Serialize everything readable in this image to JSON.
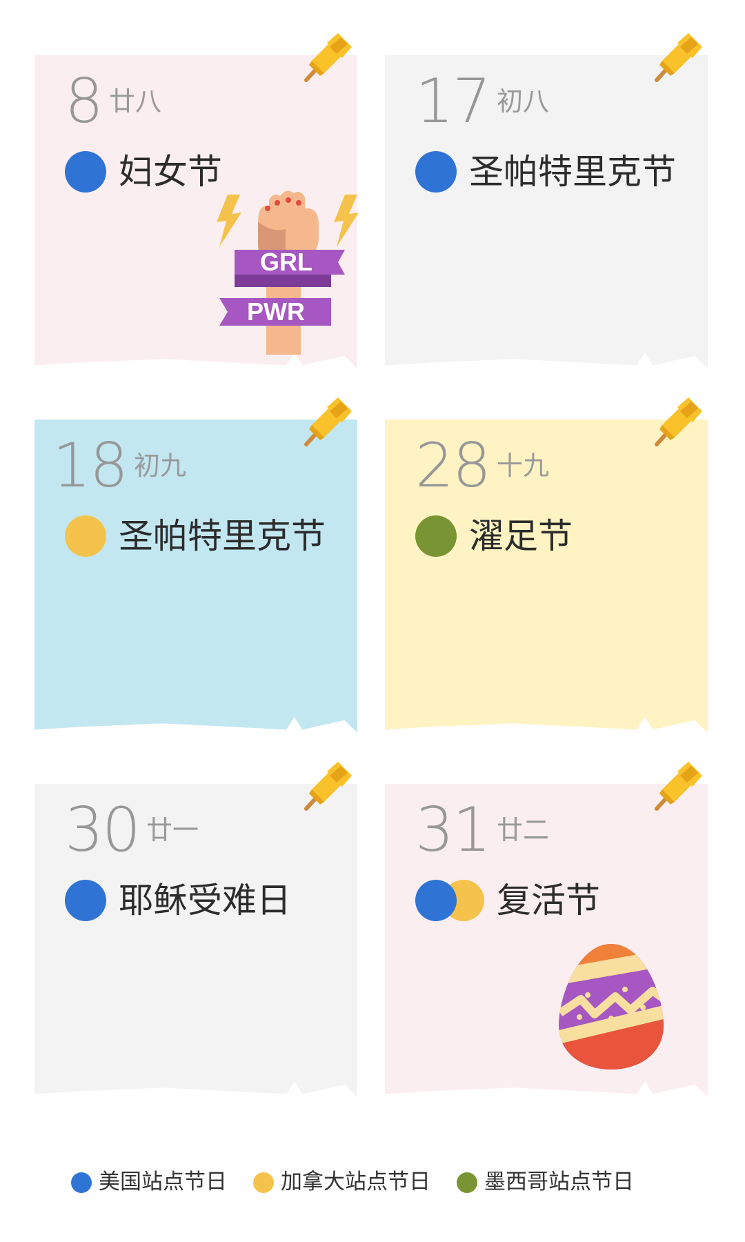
{
  "colors": {
    "us": "#2f74d5",
    "canada": "#f5c34c",
    "mexico": "#799533",
    "pin": "#f9c12a",
    "pin_dark": "#e6a317",
    "pin_needle": "#cf8a3a"
  },
  "cards": [
    {
      "day": "8",
      "lunar": "廿八",
      "holiday": "妇女节",
      "dots": [
        "us"
      ],
      "art": "grl-pwr-fist-icon",
      "art_text": [
        "GRL",
        "PWR"
      ]
    },
    {
      "day": "17",
      "lunar": "初八",
      "holiday": "圣帕特里克节",
      "dots": [
        "us"
      ]
    },
    {
      "day": "18",
      "lunar": "初九",
      "holiday": "圣帕特里克节",
      "dots": [
        "canada"
      ]
    },
    {
      "day": "28",
      "lunar": "十九",
      "holiday": "濯足节",
      "dots": [
        "mexico"
      ]
    },
    {
      "day": "30",
      "lunar": "廿一",
      "holiday": "耶稣受难日",
      "dots": [
        "us"
      ]
    },
    {
      "day": "31",
      "lunar": "廿二",
      "holiday": "复活节",
      "dots": [
        "us",
        "canada"
      ],
      "art": "easter-egg-icon"
    }
  ],
  "legend": [
    {
      "key": "us",
      "label": "美国站点节日"
    },
    {
      "key": "canada",
      "label": "加拿大站点节日"
    },
    {
      "key": "mexico",
      "label": "墨西哥站点节日"
    }
  ]
}
